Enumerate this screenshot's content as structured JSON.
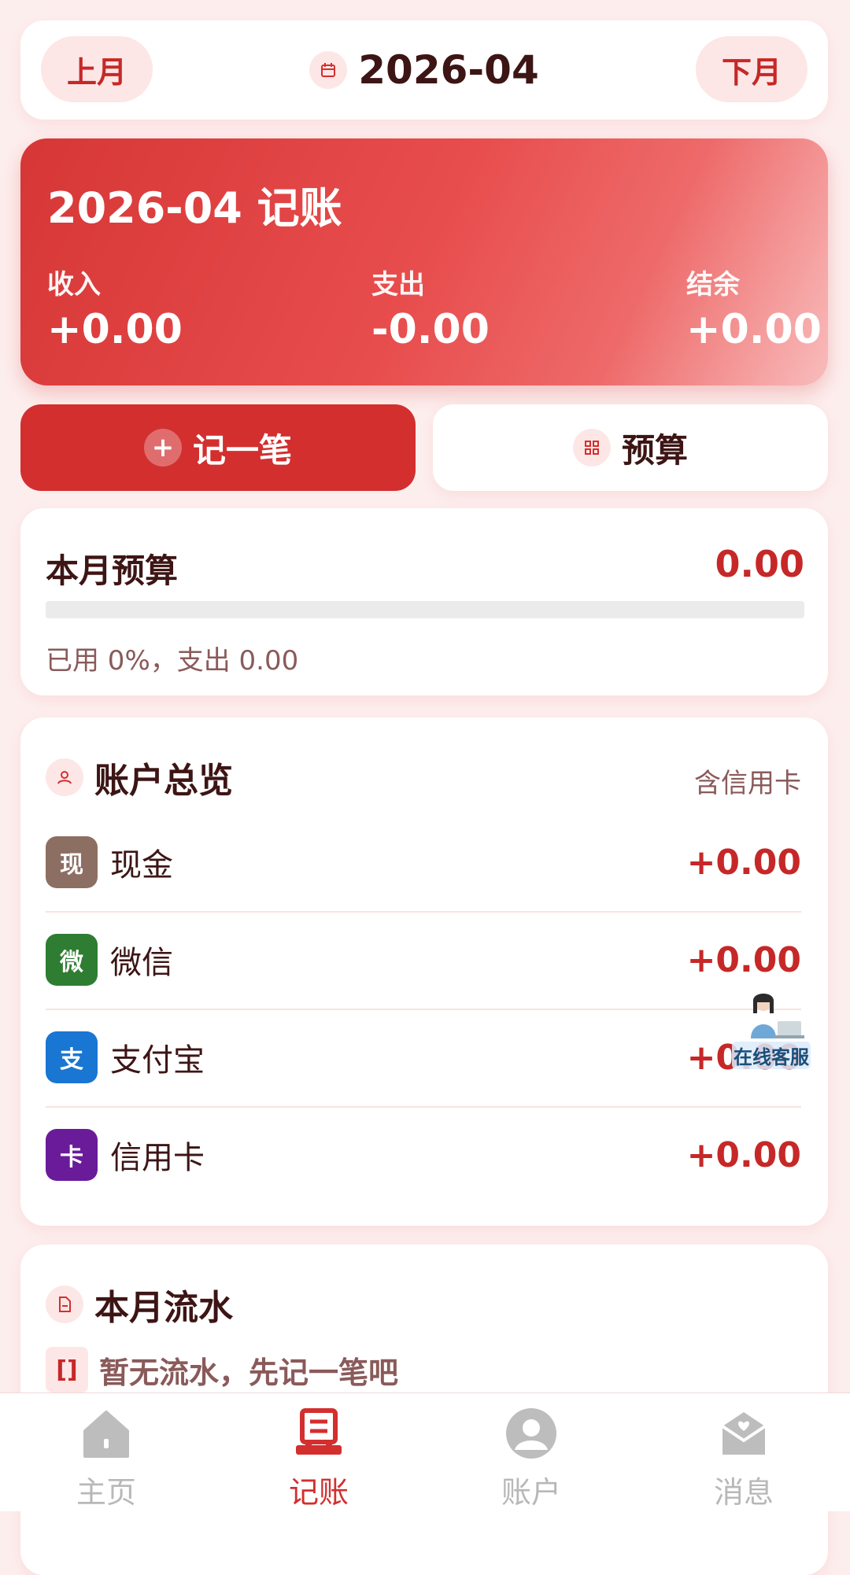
{
  "month_bar": {
    "prev_label": "上月",
    "next_label": "下月",
    "current_month": "2026-04",
    "calendar_icon": "calendar-icon"
  },
  "summary": {
    "title": "2026-04 记账",
    "income_label": "收入",
    "income_value": "+0.00",
    "expense_label": "支出",
    "expense_value": "-0.00",
    "balance_label": "结余",
    "balance_value": "+0.00"
  },
  "actions": {
    "record_label": "记一笔",
    "record_icon": "plus-icon",
    "budget_label": "预算",
    "budget_icon": "grid-icon"
  },
  "budget": {
    "label": "本月预算",
    "amount": "0.00",
    "used_percent": 0,
    "note": "已用 0%，支出 0.00"
  },
  "accounts": {
    "title": "账户总览",
    "hint": "含信用卡",
    "icon": "user-icon",
    "items": [
      {
        "badge": "现",
        "name": "现金",
        "value": "+0.00",
        "color": "#8d6e63"
      },
      {
        "badge": "微",
        "name": "微信",
        "value": "+0.00",
        "color": "#2e7d32"
      },
      {
        "badge": "支",
        "name": "支付宝",
        "value": "+0.00",
        "color": "#1976d2"
      },
      {
        "badge": "卡",
        "name": "信用卡",
        "value": "+0.00",
        "color": "#6a1b9a"
      }
    ]
  },
  "flow": {
    "title": "本月流水",
    "icon": "document-icon",
    "empty_icon_text": "[]",
    "empty_text": "暂无流水，先记一笔吧"
  },
  "cs": {
    "label": "在线客服"
  },
  "tabbar": {
    "items": [
      {
        "label": "主页",
        "icon": "home-icon",
        "active": false
      },
      {
        "label": "记账",
        "icon": "ledger-icon",
        "active": true
      },
      {
        "label": "账户",
        "icon": "user-icon",
        "active": false
      },
      {
        "label": "消息",
        "icon": "message-icon",
        "active": false
      }
    ]
  },
  "colors": {
    "accent": "#d32f2f",
    "background": "#fdeeee"
  }
}
